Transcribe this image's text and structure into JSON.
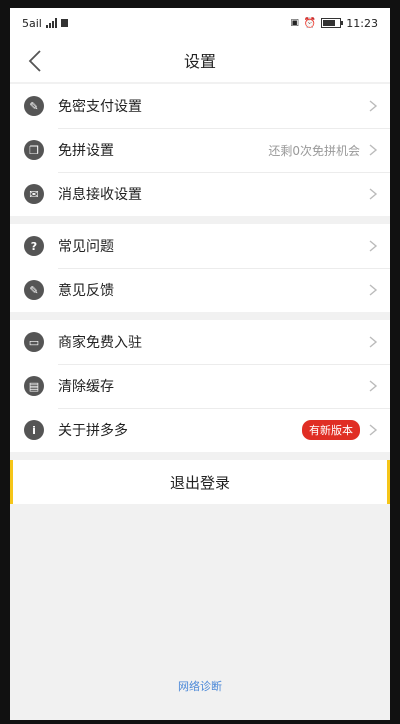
{
  "status": {
    "carrier": "5ail",
    "time": "11:23"
  },
  "nav": {
    "title": "设置",
    "back_icon": "chevron-left-icon"
  },
  "groups": [
    {
      "items": [
        {
          "label": "免密支付设置",
          "icon": "key-icon",
          "glyph": "✎",
          "extra": "",
          "badge": ""
        },
        {
          "label": "免拼设置",
          "icon": "copy-icon",
          "glyph": "❐",
          "extra": "还剩0次免拼机会",
          "badge": ""
        },
        {
          "label": "消息接收设置",
          "icon": "mail-icon",
          "glyph": "✉",
          "extra": "",
          "badge": ""
        }
      ]
    },
    {
      "items": [
        {
          "label": "常见问题",
          "icon": "question-icon",
          "glyph": "?",
          "extra": "",
          "badge": ""
        },
        {
          "label": "意见反馈",
          "icon": "edit-icon",
          "glyph": "✎",
          "extra": "",
          "badge": ""
        }
      ]
    },
    {
      "items": [
        {
          "label": "商家免费入驻",
          "icon": "store-icon",
          "glyph": "▭",
          "extra": "",
          "badge": ""
        },
        {
          "label": "清除缓存",
          "icon": "trash-icon",
          "glyph": "▤",
          "extra": "",
          "badge": ""
        },
        {
          "label": "关于拼多多",
          "icon": "info-icon",
          "glyph": "i",
          "extra": "",
          "badge": "有新版本"
        }
      ]
    }
  ],
  "logout_label": "退出登录",
  "diagnose_label": "网络诊断",
  "colors": {
    "accent_yellow": "#f5c518",
    "badge_red": "#e02e24",
    "link_blue": "#4a88d8"
  }
}
